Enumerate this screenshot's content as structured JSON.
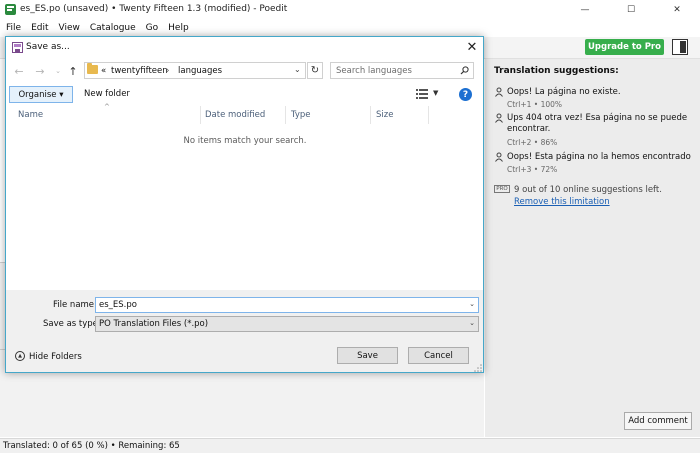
{
  "app": {
    "title": "es_ES.po (unsaved) • Twenty Fifteen 1.3 (modified) - Poedit",
    "window_controls": {
      "minimize": "—",
      "maximize": "☐",
      "close": "✕"
    },
    "menu": [
      "File",
      "Edit",
      "View",
      "Catalogue",
      "Go",
      "Help"
    ],
    "upgrade_label": "Upgrade to Pro",
    "brand_color": "#37ae4c"
  },
  "suggestions": {
    "heading": "Translation suggestions:",
    "items": [
      {
        "text": "Oops! La página no existe.",
        "meta": "Ctrl+1 • 100%"
      },
      {
        "text": "Ups 404 otra vez! Esa página no se puede encontrar.",
        "meta": "Ctrl+2 • 86%"
      },
      {
        "text": "Oops! Esta página no la hemos encontrado",
        "meta": "Ctrl+3 • 72%"
      }
    ],
    "pro_badge": "PRO",
    "online_note": "9 out of 10 online suggestions left.",
    "remove_limit": "Remove this limitation",
    "add_comment": "Add comment"
  },
  "status": {
    "text": "Translated: 0 of 65 (0 %)  •  Remaining: 65"
  },
  "dialog": {
    "title": "Save as...",
    "close": "✕",
    "breadcrumb": {
      "prefix": "«",
      "items": [
        "twentyfifteen",
        "languages"
      ]
    },
    "search_placeholder": "Search languages",
    "organise_label": "Organise ▾",
    "new_folder_label": "New folder",
    "help_label": "?",
    "columns": [
      "Name",
      "Date modified",
      "Type",
      "Size"
    ],
    "empty_message": "No items match your search.",
    "file_name_label": "File name:",
    "file_name_value": "es_ES.po",
    "save_type_label": "Save as type:",
    "save_type_value": "PO Translation Files (*.po)",
    "hide_folders_label": "Hide Folders",
    "save_label": "Save",
    "cancel_label": "Cancel",
    "accent_color": "#45a7c9"
  }
}
